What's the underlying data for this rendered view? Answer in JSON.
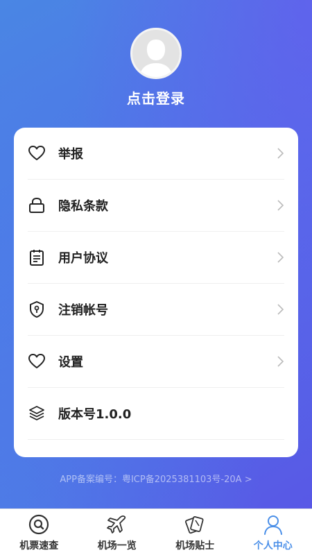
{
  "header": {
    "login_label": "点击登录"
  },
  "menu": {
    "items": [
      {
        "label": "举报",
        "icon": "heart-icon"
      },
      {
        "label": "隐私条款",
        "icon": "lock-icon"
      },
      {
        "label": "用户协议",
        "icon": "document-icon"
      },
      {
        "label": "注销帐号",
        "icon": "shield-icon"
      },
      {
        "label": "设置",
        "icon": "heart-icon"
      },
      {
        "label": "版本号1.0.0",
        "icon": "layers-icon"
      }
    ]
  },
  "footer": {
    "beian": "APP备案编号：粤ICP备2025381103号-20A >"
  },
  "tabbar": {
    "tabs": [
      {
        "label": "机票速查",
        "icon": "search-icon"
      },
      {
        "label": "机场一览",
        "icon": "airplane-icon"
      },
      {
        "label": "机场贴士",
        "icon": "cards-icon"
      },
      {
        "label": "个人中心",
        "icon": "person-icon"
      }
    ],
    "active_color": "#4a8fe8"
  },
  "colors": {
    "background_start": "#4a86e4",
    "background_end": "#5a55e6",
    "card": "#ffffff"
  }
}
